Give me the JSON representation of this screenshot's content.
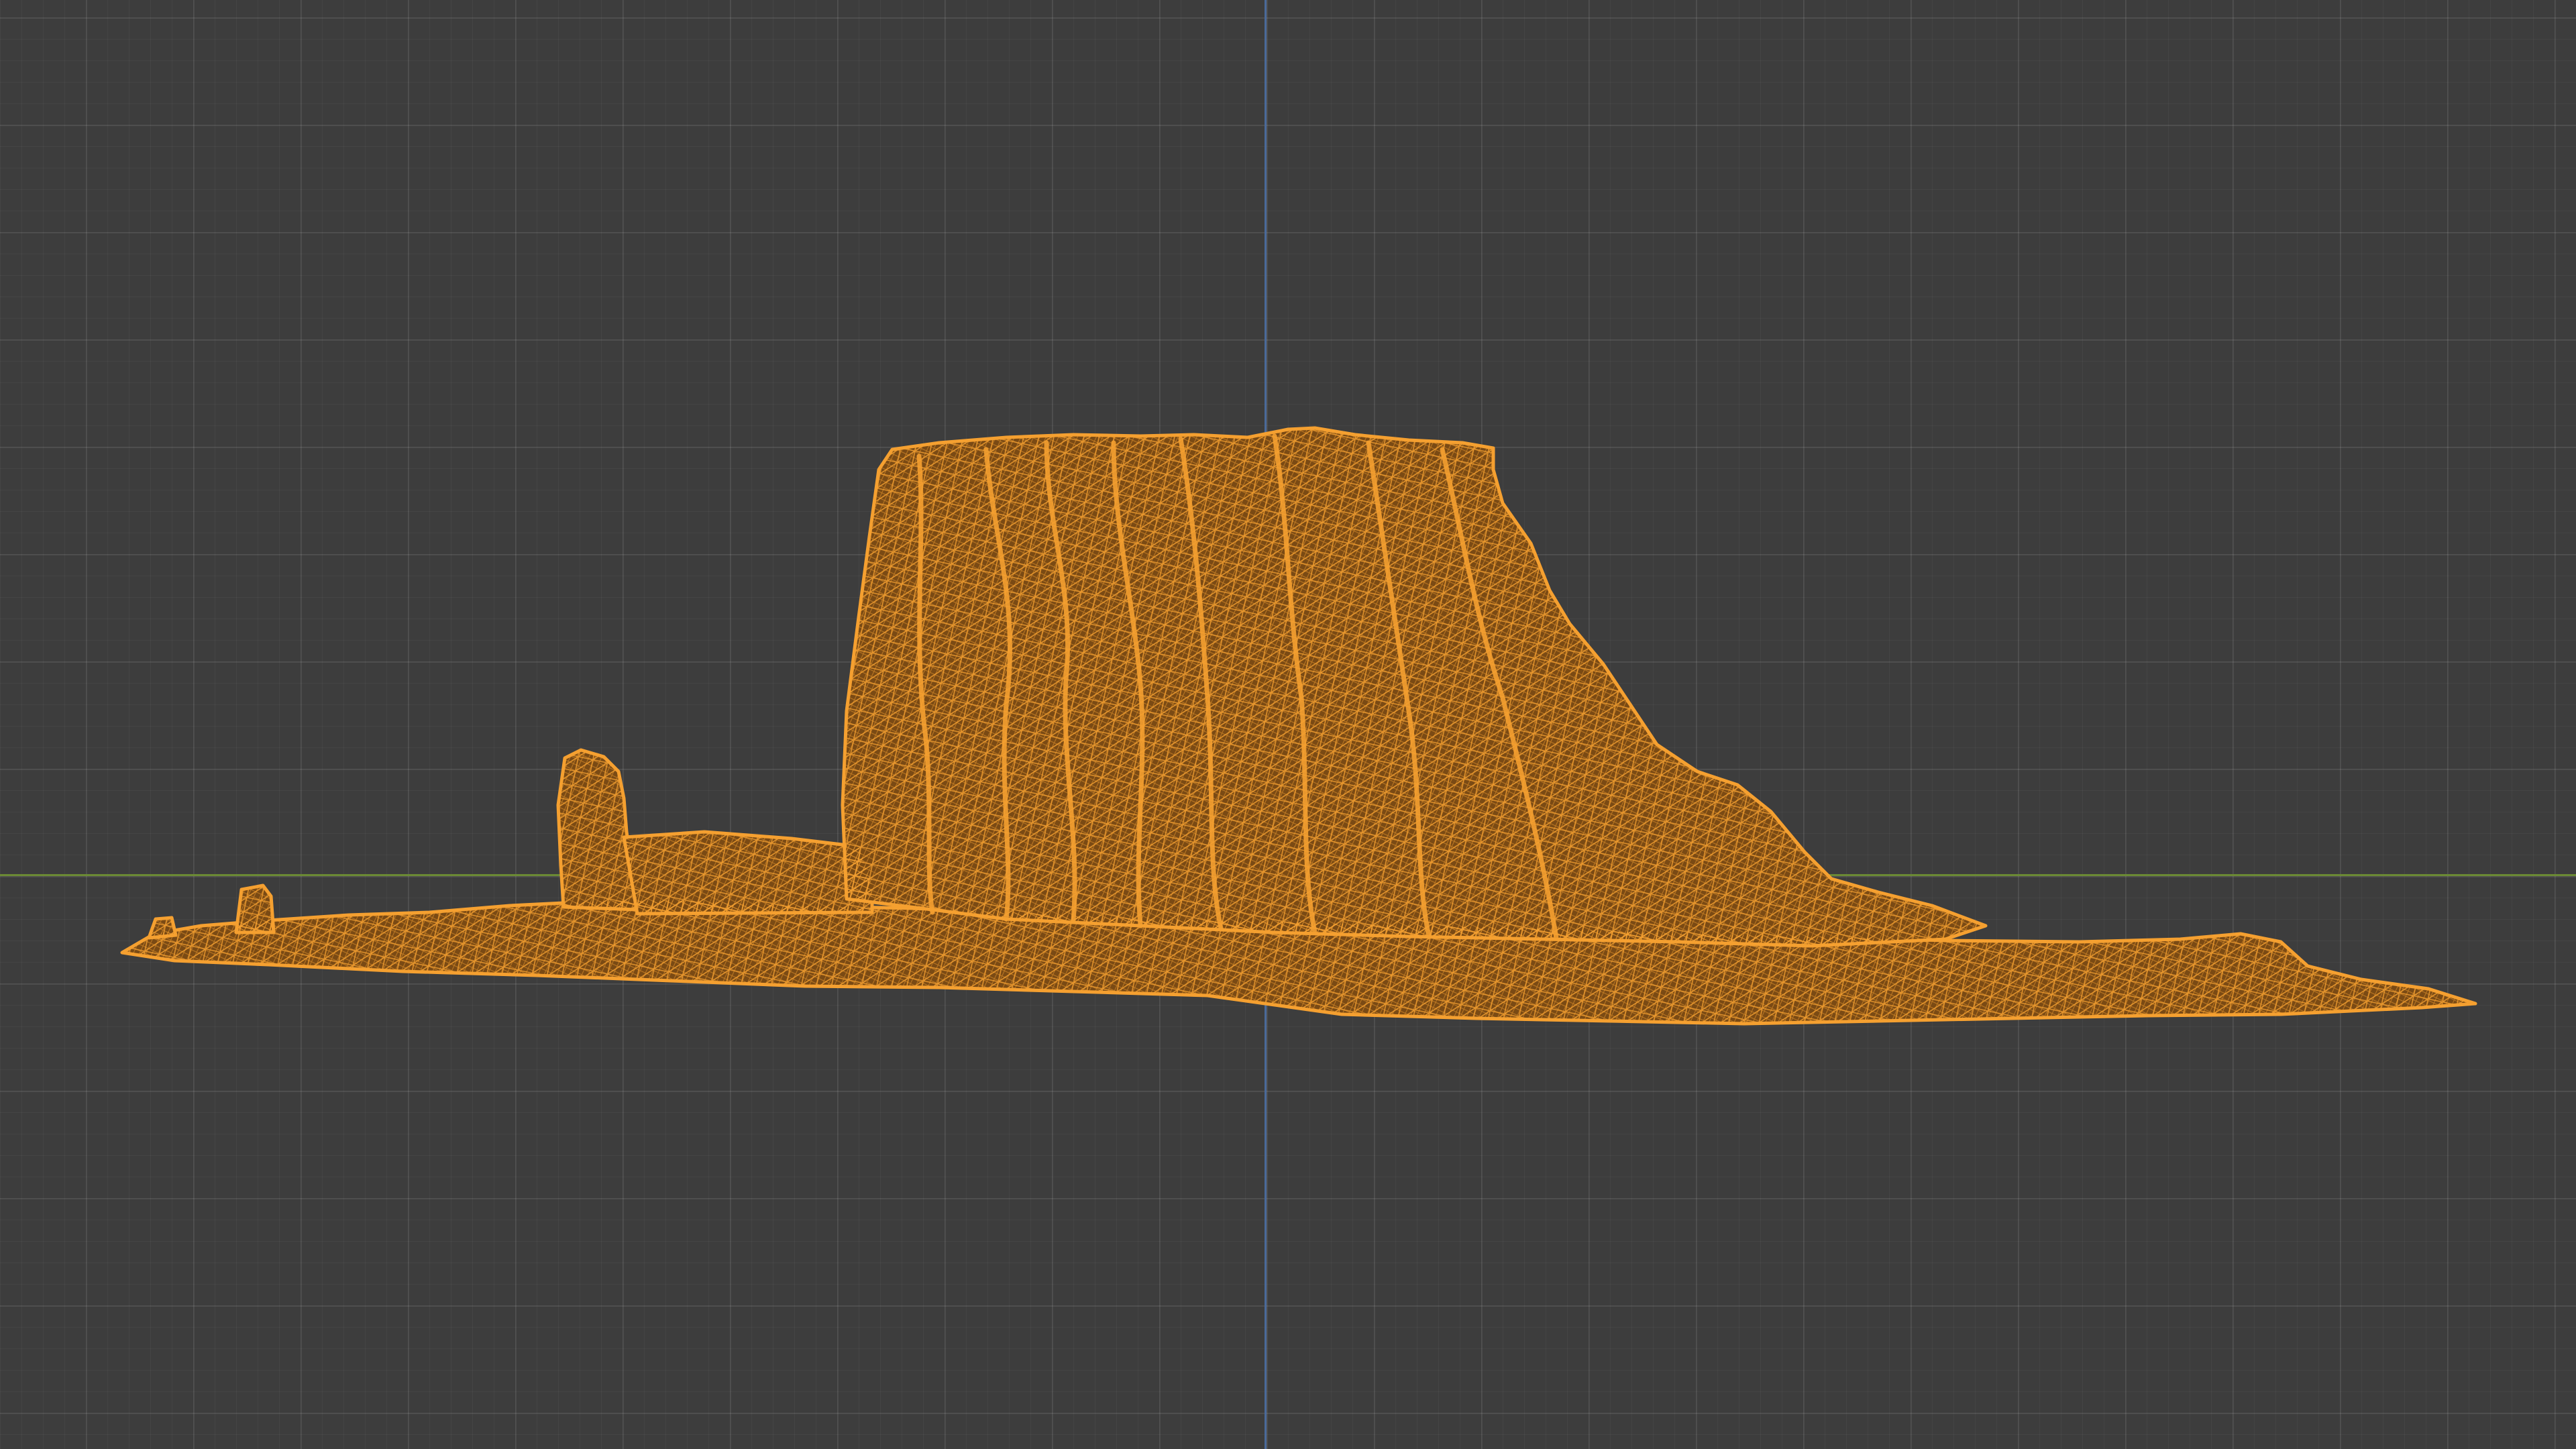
{
  "viewport": {
    "background_color": "#3d3d3d",
    "grid_color": "#4a4a4a",
    "axis_x_color": "#6b8a34",
    "axis_y_color": "#4a6a9a"
  },
  "object": {
    "type": "mesh",
    "display": "wireframe",
    "selected": true,
    "wire_color": "#f5a030",
    "fill_color": "#7a4a14",
    "shadow_color": "#4a2e10"
  }
}
